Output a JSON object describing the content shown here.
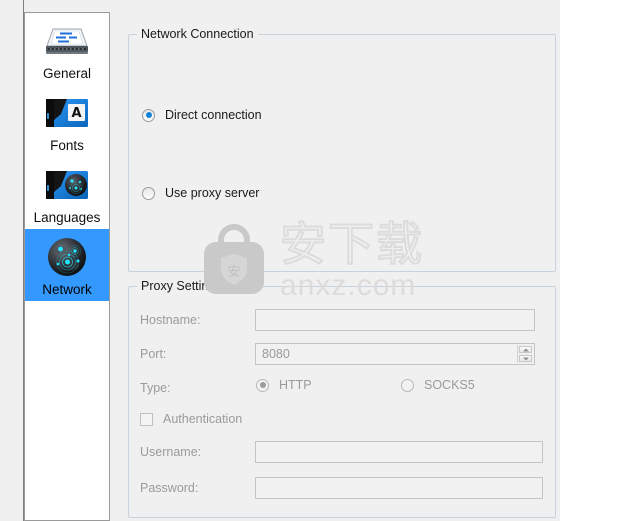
{
  "sidebar": {
    "items": [
      {
        "label": "General",
        "icon": "hard-drive-icon",
        "selected": false
      },
      {
        "label": "Fonts",
        "icon": "folder-font-icon",
        "selected": false
      },
      {
        "label": "Languages",
        "icon": "folder-globe-icon",
        "selected": false
      },
      {
        "label": "Network",
        "icon": "network-globe-icon",
        "selected": true
      }
    ]
  },
  "network_connection": {
    "title": "Network Connection",
    "options": [
      {
        "label": "Direct connection",
        "checked": true,
        "enabled": true
      },
      {
        "label": "Use proxy server",
        "checked": false,
        "enabled": true
      }
    ]
  },
  "proxy_settings": {
    "title": "Proxy Settings",
    "hostname": {
      "label": "Hostname:",
      "value": "",
      "placeholder": ""
    },
    "port": {
      "label": "Port:",
      "value": "8080"
    },
    "type": {
      "label": "Type:",
      "options": [
        {
          "label": "HTTP",
          "checked": true
        },
        {
          "label": "SOCKS5",
          "checked": false
        }
      ]
    },
    "authentication": {
      "label": "Authentication",
      "checked": false
    },
    "username": {
      "label": "Username:",
      "value": ""
    },
    "password": {
      "label": "Password:",
      "value": ""
    }
  },
  "watermark": {
    "cjk": "安下载",
    "domain": "anxz.com",
    "badge_char": "安"
  },
  "colors": {
    "selection": "#3399ff",
    "accent_radio": "#1184d6",
    "panel_bg": "#f0f0f0",
    "groupbox_border": "#c8d2dc",
    "disabled_text": "#9a9a9a"
  }
}
